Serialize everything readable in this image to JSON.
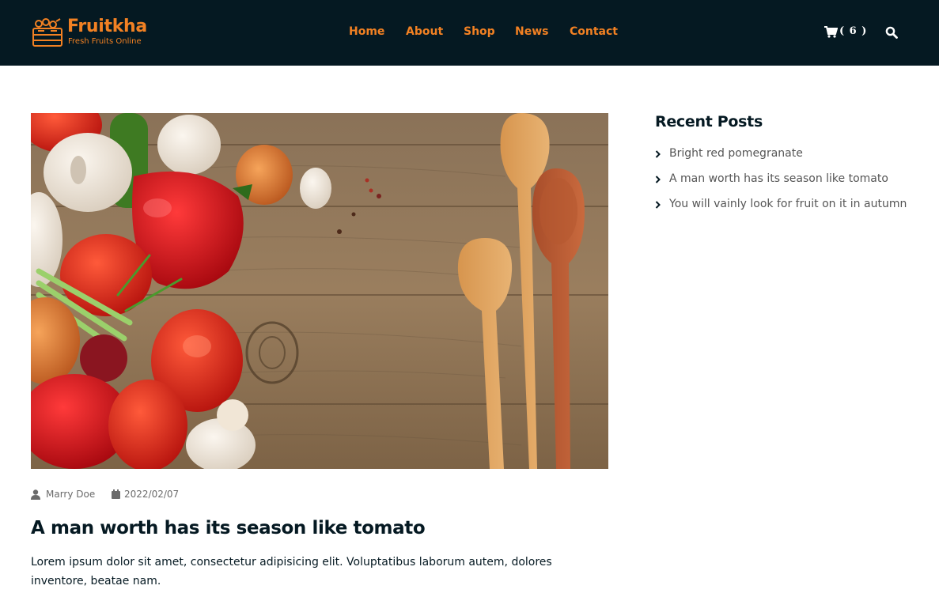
{
  "brand": {
    "name": "Fruitkha",
    "tagline": "Fresh Fruits Online",
    "accent_color": "#F28123",
    "header_bg": "#051922"
  },
  "nav": {
    "items": [
      {
        "label": "Home"
      },
      {
        "label": "About"
      },
      {
        "label": "Shop"
      },
      {
        "label": "News"
      },
      {
        "label": "Contact"
      }
    ]
  },
  "cart": {
    "icon": "cart-icon",
    "count_text": "( 6 )"
  },
  "search": {
    "icon": "search-icon"
  },
  "post": {
    "image": "vegetables-and-wooden-spoons-photo",
    "author": "Marry Doe",
    "date": "2022/02/07",
    "title": "A man worth has its season like tomato",
    "excerpt": "Lorem ipsum dolor sit amet, consectetur adipisicing elit. Voluptatibus laborum autem, dolores inventore, beatae nam."
  },
  "sidebar": {
    "title": "Recent Posts",
    "items": [
      {
        "label": "Bright red pomegranate"
      },
      {
        "label": "A man worth has its season like tomato"
      },
      {
        "label": "You will vainly look for fruit on it in autumn"
      }
    ]
  }
}
